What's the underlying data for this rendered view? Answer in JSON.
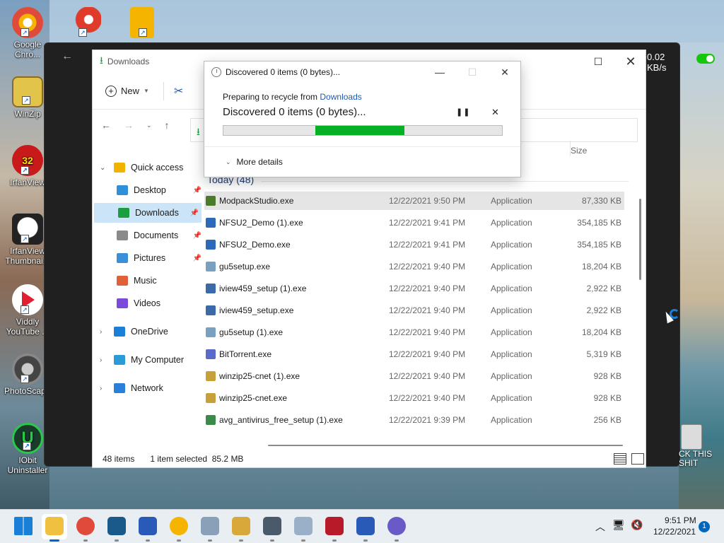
{
  "desktop": {
    "icons": [
      {
        "label": "Google Chro...",
        "color": "#f4b400"
      },
      {
        "label": "WinZip",
        "color": "#e2c44a"
      },
      {
        "label": "IrfanView",
        "color": "#d92020"
      },
      {
        "label": "IrfanView Thumbnai...",
        "color": "#444444"
      },
      {
        "label": "Viddly YouTube ...",
        "color": "#e02030"
      },
      {
        "label": "PhotoScap...",
        "color": "#555555"
      },
      {
        "label": "IObit Uninstaller",
        "color": "#1a8a3a"
      }
    ],
    "top_icons": [
      {
        "name": "ccleaner-icon",
        "color": "#e03a2a"
      },
      {
        "name": "slides-icon",
        "color": "#f4b400"
      }
    ],
    "irfanview_badge": "32",
    "recycle_label": "CK THIS SHIT"
  },
  "back_window": {
    "speed": "0.02 KB/s"
  },
  "explorer": {
    "title": "Downloads",
    "toolbar": {
      "new_label": "New"
    },
    "sidebar": [
      {
        "label": "Quick access",
        "color": "#f0b400",
        "indent": 0,
        "expander": "v",
        "pin": false
      },
      {
        "label": "Desktop",
        "color": "#2f8fd8",
        "indent": 1,
        "expander": "",
        "pin": true
      },
      {
        "label": "Downloads",
        "color": "#1a9e3f",
        "indent": 1,
        "expander": "",
        "pin": true,
        "selected": true
      },
      {
        "label": "Documents",
        "color": "#8a8a8a",
        "indent": 1,
        "expander": "",
        "pin": true
      },
      {
        "label": "Pictures",
        "color": "#3a8fd8",
        "indent": 1,
        "expander": "",
        "pin": true
      },
      {
        "label": "Music",
        "color": "#e0603a",
        "indent": 1,
        "expander": "",
        "pin": false
      },
      {
        "label": "Videos",
        "color": "#7a4ad8",
        "indent": 1,
        "expander": "",
        "pin": false
      },
      {
        "label": "OneDrive",
        "color": "#1a7fd6",
        "indent": 0,
        "expander": ">",
        "pin": false
      },
      {
        "label": "My Computer",
        "color": "#2a9ad8",
        "indent": 0,
        "expander": ">",
        "pin": false
      },
      {
        "label": "Network",
        "color": "#2a7fd8",
        "indent": 0,
        "expander": ">",
        "pin": false
      }
    ],
    "column_size": "Size",
    "group": "Today (48)",
    "files": [
      {
        "name": "ModpackStudio.exe",
        "date": "12/22/2021 9:50 PM",
        "type": "Application",
        "size": "87,330 KB",
        "color": "#4a7a2a",
        "selected": true
      },
      {
        "name": "NFSU2_Demo (1).exe",
        "date": "12/22/2021 9:41 PM",
        "type": "Application",
        "size": "354,185 KB",
        "color": "#2a6ab8"
      },
      {
        "name": "NFSU2_Demo.exe",
        "date": "12/22/2021 9:41 PM",
        "type": "Application",
        "size": "354,185 KB",
        "color": "#2a6ab8"
      },
      {
        "name": "gu5setup.exe",
        "date": "12/22/2021 9:40 PM",
        "type": "Application",
        "size": "18,204 KB",
        "color": "#7aa0c0"
      },
      {
        "name": "iview459_setup (1).exe",
        "date": "12/22/2021 9:40 PM",
        "type": "Application",
        "size": "2,922 KB",
        "color": "#3a6aa8"
      },
      {
        "name": "iview459_setup.exe",
        "date": "12/22/2021 9:40 PM",
        "type": "Application",
        "size": "2,922 KB",
        "color": "#3a6aa8"
      },
      {
        "name": "gu5setup (1).exe",
        "date": "12/22/2021 9:40 PM",
        "type": "Application",
        "size": "18,204 KB",
        "color": "#7aa0c0"
      },
      {
        "name": "BitTorrent.exe",
        "date": "12/22/2021 9:40 PM",
        "type": "Application",
        "size": "5,319 KB",
        "color": "#5a6ac8"
      },
      {
        "name": "winzip25-cnet (1).exe",
        "date": "12/22/2021 9:40 PM",
        "type": "Application",
        "size": "928 KB",
        "color": "#c8a03a"
      },
      {
        "name": "winzip25-cnet.exe",
        "date": "12/22/2021 9:40 PM",
        "type": "Application",
        "size": "928 KB",
        "color": "#c8a03a"
      },
      {
        "name": "avg_antivirus_free_setup (1).exe",
        "date": "12/22/2021 9:39 PM",
        "type": "Application",
        "size": "256 KB",
        "color": "#3a8a4a"
      }
    ],
    "status": {
      "count": "48 items",
      "selection": "1 item selected",
      "selection_size": "85.2 MB"
    }
  },
  "dialog": {
    "title": "Discovered 0 items (0 bytes)...",
    "sub_prefix": "Preparing to recycle from ",
    "sub_link": "Downloads",
    "main": "Discovered 0 items (0 bytes)...",
    "progress": {
      "start": 0.33,
      "end": 0.65
    },
    "more_details": "More details"
  },
  "taskbar": {
    "apps": [
      {
        "name": "start-icon",
        "color": "#1a7fd6"
      },
      {
        "name": "file-explorer-icon",
        "color": "#f0c040",
        "active": true
      },
      {
        "name": "chrome-icon",
        "color": "#e04a3a"
      },
      {
        "name": "shield-app-icon",
        "color": "#1a5a8a"
      },
      {
        "name": "malwarebytes-icon",
        "color": "#2a5ab8"
      },
      {
        "name": "slides-app-icon",
        "color": "#f4b400"
      },
      {
        "name": "installer-icon",
        "color": "#8aa0b8"
      },
      {
        "name": "winzip-app-icon",
        "color": "#d8a83a"
      },
      {
        "name": "ccleaner-app-icon",
        "color": "#4a5a6a"
      },
      {
        "name": "setup-app-icon",
        "color": "#9ab0c8"
      },
      {
        "name": "recorder-icon",
        "color": "#b81a2a"
      },
      {
        "name": "malwarebytes2-icon",
        "color": "#2a5ab8"
      },
      {
        "name": "bittorrent-app-icon",
        "color": "#6a5ac8"
      }
    ],
    "time": "9:51 PM",
    "date": "12/22/2021",
    "notifications": "1"
  }
}
